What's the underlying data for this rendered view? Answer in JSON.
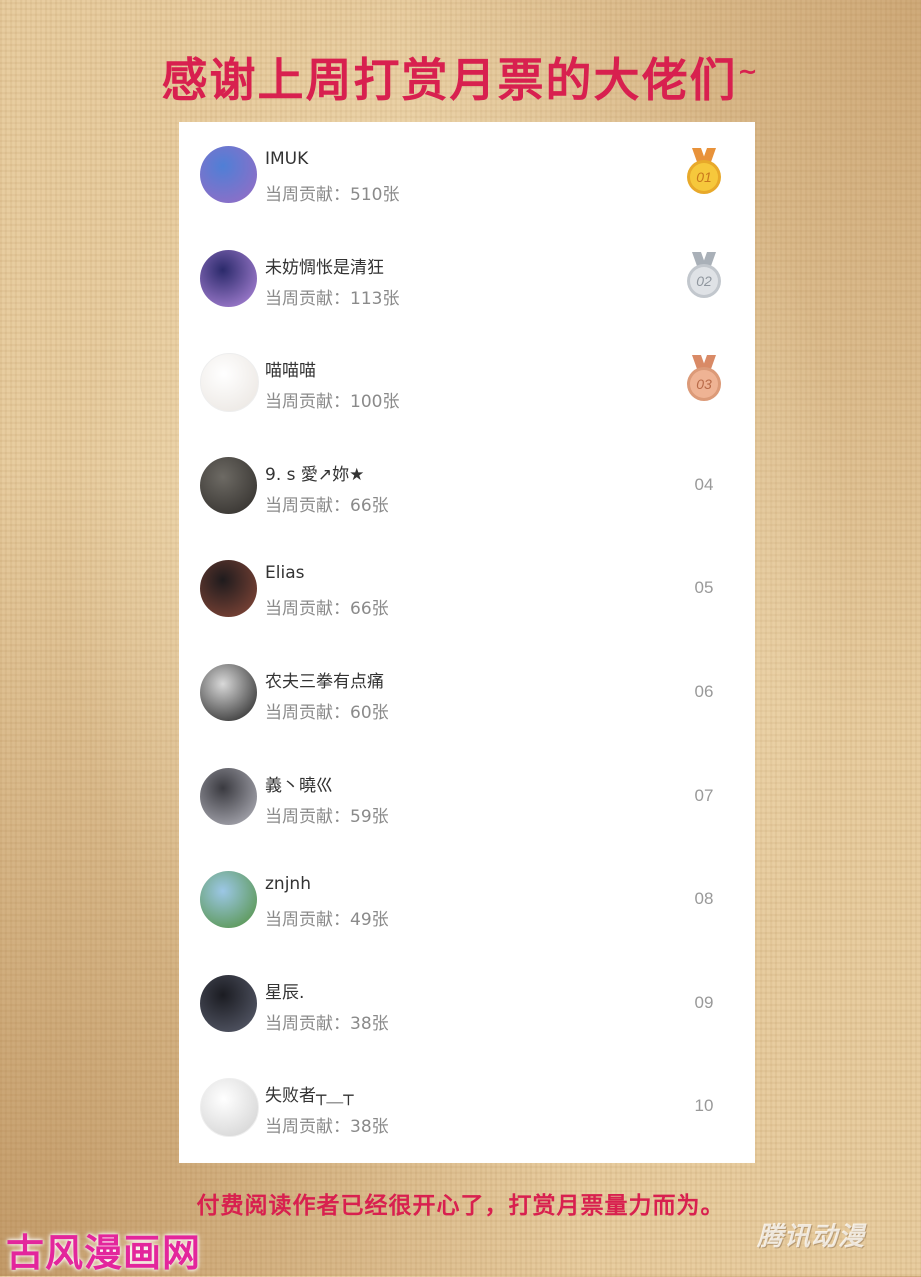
{
  "title": {
    "main": "感谢上周打赏月票的大佬们",
    "tilde": "~"
  },
  "leaderboard": {
    "rows": [
      {
        "name": "IMUK",
        "contribution": "当周贡献：510张",
        "rank": "01",
        "medal": "gold",
        "avatar_icon": "cartoon-avatar-icon",
        "avatar_colors": [
          "#4f7fd6",
          "#9b6bc4"
        ]
      },
      {
        "name": "未妨惆怅是清狂",
        "contribution": "当周贡献：113张",
        "rank": "02",
        "medal": "silver",
        "avatar_icon": "anime-avatar-icon",
        "avatar_colors": [
          "#2b2a6b",
          "#b58be0"
        ]
      },
      {
        "name": "喵喵喵",
        "contribution": "当周贡献：100张",
        "rank": "03",
        "medal": "bronze",
        "avatar_icon": "cat-sticker-avatar-icon",
        "avatar_colors": [
          "#ffffff",
          "#e9e4df"
        ]
      },
      {
        "name": "9. s 愛↗妳★",
        "contribution": "当周贡献：66张",
        "rank": "04",
        "medal": "",
        "avatar_icon": "person-avatar-icon",
        "avatar_colors": [
          "#6d6a64",
          "#2e2b28"
        ]
      },
      {
        "name": "Elias",
        "contribution": "当周贡献：66张",
        "rank": "05",
        "medal": "",
        "avatar_icon": "dark-scene-avatar-icon",
        "avatar_colors": [
          "#1f1b1d",
          "#8c4a3a"
        ]
      },
      {
        "name": "农夫三拳有点痛",
        "contribution": "当周贡献：60张",
        "rank": "06",
        "medal": "",
        "avatar_icon": "suit-man-avatar-icon",
        "avatar_colors": [
          "#d9d9d9",
          "#1a1a1a"
        ]
      },
      {
        "name": "義丶曉巛",
        "contribution": "当周贡献：59张",
        "rank": "07",
        "medal": "",
        "avatar_icon": "anime-boy-avatar-icon",
        "avatar_colors": [
          "#3a3a40",
          "#b9b9c2"
        ]
      },
      {
        "name": "znjnh",
        "contribution": "当周贡献：49张",
        "rank": "08",
        "medal": "",
        "avatar_icon": "landscape-avatar-icon",
        "avatar_colors": [
          "#9cc7e6",
          "#4f8f3a"
        ]
      },
      {
        "name": "星辰.",
        "contribution": "当周贡献：38张",
        "rank": "09",
        "medal": "",
        "avatar_icon": "anime-dark-avatar-icon",
        "avatar_colors": [
          "#1b1c22",
          "#5c6070"
        ]
      },
      {
        "name": "失败者┬＿┬",
        "contribution": "当周贡献：38张",
        "rank": "10",
        "medal": "",
        "avatar_icon": "sketch-girl-avatar-icon",
        "avatar_colors": [
          "#ffffff",
          "#cfcfcf"
        ]
      }
    ]
  },
  "footer": {
    "text": "付费阅读作者已经很开心了，打赏月票量力而为。"
  },
  "watermarks": {
    "left": "古风漫画网",
    "right": "腾讯动漫"
  },
  "colors": {
    "accent": "#d8204f",
    "gold": "#f3c437",
    "silver": "#c9cdd2",
    "bronze": "#e2a07c"
  }
}
